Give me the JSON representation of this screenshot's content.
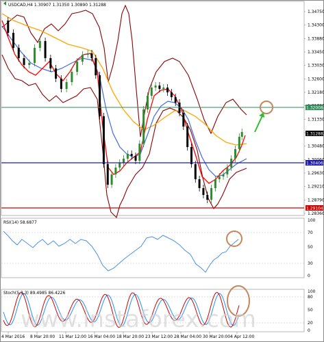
{
  "header": {
    "symbol_line": "USDCAD,H4  1.30907 1.31350 1.30890 1.31288",
    "rsi_label": "RSI(14) 58.6877",
    "stoch_label": "Stoch(5,3,3) 89.4985 86.4226"
  },
  "price_axis": {
    "ticks": [
      "1.34750",
      "1.34300",
      "1.33880",
      "1.33450",
      "1.33030",
      "1.32600",
      "1.32180",
      "1.31760",
      "1.31330",
      "1.30910",
      "1.30480",
      "1.30060",
      "1.29630",
      "1.29210",
      "1.28790",
      "1.28360"
    ]
  },
  "levels": {
    "green": {
      "value": "1.32008",
      "color": "#2e8b57"
    },
    "current": {
      "value": "1.31288",
      "color": "#000000"
    },
    "blue": {
      "value": "1.30406",
      "color": "#1a1aa8"
    },
    "red": {
      "value": "1.29104",
      "color": "#d00000"
    }
  },
  "rsi_axis": {
    "ticks": [
      "100",
      "70",
      "50",
      "30",
      "0"
    ]
  },
  "stoch_axis": {
    "ticks": [
      "100",
      "80",
      "50",
      "20",
      "0"
    ]
  },
  "time_axis": {
    "ticks": [
      "4 Mar 2016",
      "8 Mar 20:00",
      "11 Mar 12:00",
      "16 Mar 04:00",
      "18 Mar 20:00",
      "23 Mar 12:00",
      "28 Mar 04:00",
      "30 Mar 20:00",
      "4 Apr 12:00"
    ]
  },
  "watermark": "www.instaforex.com",
  "colors": {
    "bollinger": "#8b0000",
    "ma_fast": "#ff0000",
    "ma_mid": "#4169e1",
    "ma_slow": "#ffa500",
    "bull_candle": "#2e8b2e",
    "bear_candle": "#000000",
    "rsi_line": "#4a90e2",
    "stoch_main": "#d00000",
    "stoch_signal": "#1e90ff",
    "annotation_circle": "#c8845a",
    "arrow": "#2fbf2f"
  }
}
